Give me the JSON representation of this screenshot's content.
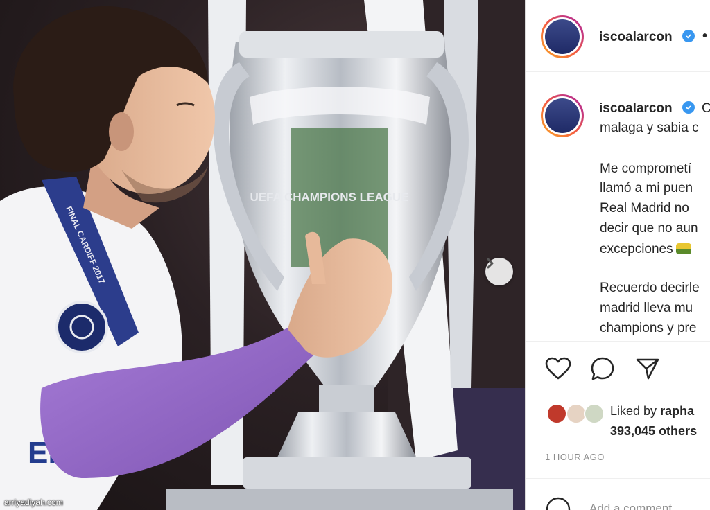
{
  "post": {
    "username": "iscoalarcon",
    "more_label": "•",
    "caption": {
      "first_line_start": "C",
      "first_line": "malaga y sabia c",
      "lines_para2": [
        "Me comprometí",
        "llamó a mi puen",
        "Real Madrid no",
        "decir que no aun",
        "excepciones"
      ],
      "emoji": "lion-emoji",
      "lines_para3": [
        "Recuerdo decirle",
        "madrid lleva mu",
        "champions y pre"
      ]
    },
    "likes": {
      "liked_by": "Liked by",
      "liker_name": "rapha",
      "others": "393,045 others"
    },
    "time_ago": "1 HOUR AGO",
    "comment_placeholder": "Add a comment..."
  },
  "photo": {
    "watermark": "arriyadiyah.com",
    "jersey_text": "Emi",
    "medal_ribbon_text": "FINAL CARDIFF 2017",
    "trophy_text": "UEFA CHAMPIONS LEAGUE"
  },
  "icons": {
    "verified": "verified-badge-icon",
    "next": "chevron-right-icon",
    "like": "heart-icon",
    "comment": "comment-bubble-icon",
    "share": "paper-plane-icon",
    "comment_emoji": "smiley-icon"
  },
  "colors": {
    "verified_blue": "#3897f0",
    "story_ring_start": "#f9a825",
    "story_ring_end": "#c13584",
    "jersey_purple": "#9a6fc8"
  }
}
